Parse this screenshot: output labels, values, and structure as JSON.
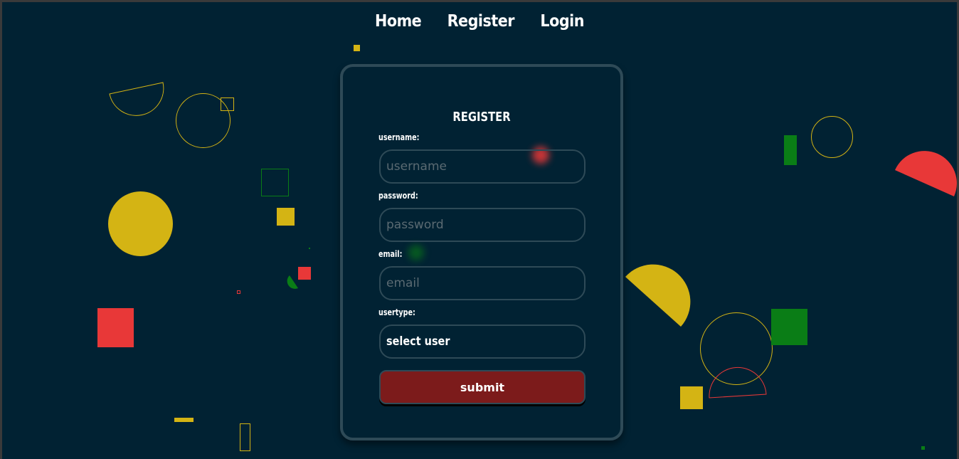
{
  "nav": {
    "items": [
      "Home",
      "Register",
      "Login"
    ]
  },
  "form": {
    "title": "REGISTER",
    "username_label": "username:",
    "username_placeholder": "username",
    "password_label": "password:",
    "password_placeholder": "password",
    "email_label": "email:",
    "email_placeholder": "email",
    "usertype_label": "usertype:",
    "usertype_value": "select user",
    "submit_label": "submit"
  },
  "colors": {
    "background": "#012233",
    "border": "#2e4a57",
    "yellow": "#d4b414",
    "red": "#e83838",
    "green": "#0a7d16",
    "submit": "#7c1b1b"
  }
}
